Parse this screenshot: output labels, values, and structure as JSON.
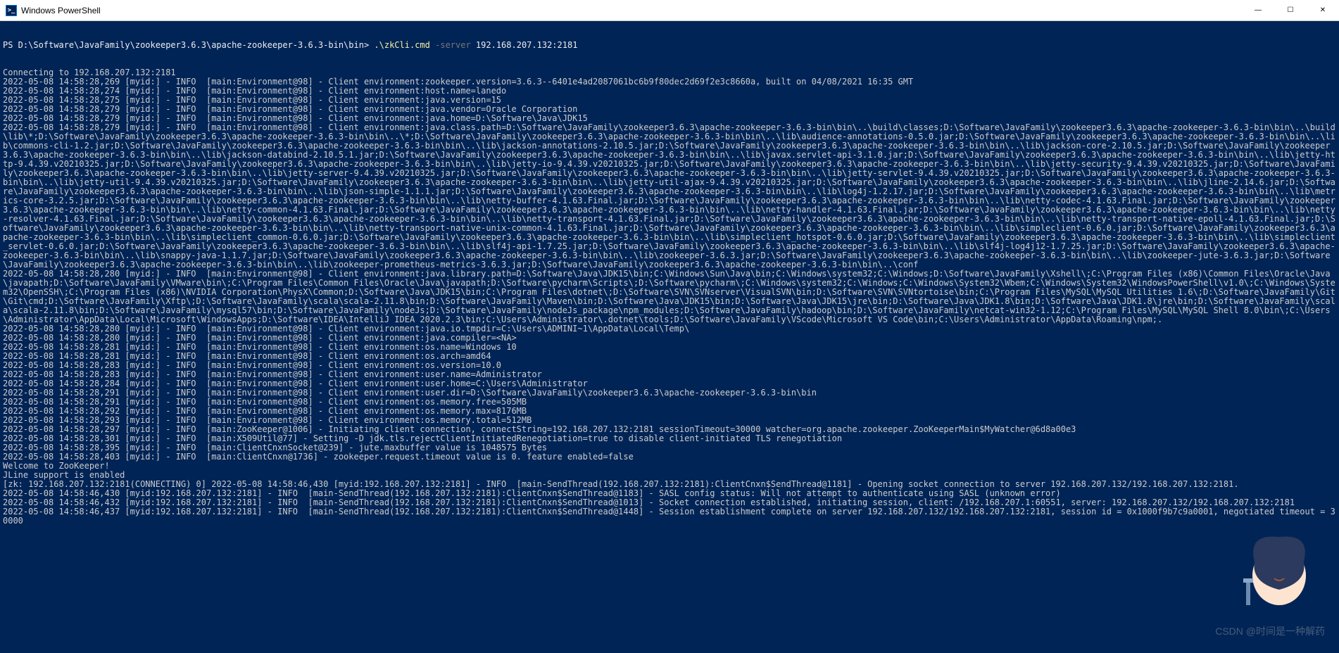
{
  "window": {
    "title": "Windows PowerShell",
    "icon_label": ">_"
  },
  "buttons": {
    "minimize": "—",
    "maximize": "☐",
    "close": "✕"
  },
  "prompt": {
    "path": "PS D:\\Software\\JavaFamily\\zookeeper3.6.3\\apache-zookeeper-3.6.3-bin\\bin> ",
    "command": ".\\zkCli.cmd",
    "flag": "-server",
    "arg": " 192.168.207.132:2181"
  },
  "lines": [
    "Connecting to 192.168.207.132:2181",
    "2022-05-08 14:58:28,269 [myid:] - INFO  [main:Environment@98] - Client environment:zookeeper.version=3.6.3--6401e4ad2087061bc6b9f80dec2d69f2e3c8660a, built on 04/08/2021 16:35 GMT",
    "2022-05-08 14:58:28,274 [myid:] - INFO  [main:Environment@98] - Client environment:host.name=lanedo",
    "2022-05-08 14:58:28,275 [myid:] - INFO  [main:Environment@98] - Client environment:java.version=15",
    "2022-05-08 14:58:28,279 [myid:] - INFO  [main:Environment@98] - Client environment:java.vendor=Oracle Corporation",
    "2022-05-08 14:58:28,279 [myid:] - INFO  [main:Environment@98] - Client environment:java.home=D:\\Software\\Java\\JDK15",
    "2022-05-08 14:58:28,279 [myid:] - INFO  [main:Environment@98] - Client environment:java.class.path=D:\\Software\\JavaFamily\\zookeeper3.6.3\\apache-zookeeper-3.6.3-bin\\bin\\..\\build\\classes;D:\\Software\\JavaFamily\\zookeeper3.6.3\\apache-zookeeper-3.6.3-bin\\bin\\..\\build\\lib\\*;D:\\Software\\JavaFamily\\zookeeper3.6.3\\apache-zookeeper-3.6.3-bin\\bin\\..\\*;D:\\Software\\JavaFamily\\zookeeper3.6.3\\apache-zookeeper-3.6.3-bin\\bin\\..\\lib\\audience-annotations-0.5.0.jar;D:\\Software\\JavaFamily\\zookeeper3.6.3\\apache-zookeeper-3.6.3-bin\\bin\\..\\lib\\commons-cli-1.2.jar;D:\\Software\\JavaFamily\\zookeeper3.6.3\\apache-zookeeper-3.6.3-bin\\bin\\..\\lib\\jackson-annotations-2.10.5.jar;D:\\Software\\JavaFamily\\zookeeper3.6.3\\apache-zookeeper-3.6.3-bin\\bin\\..\\lib\\jackson-core-2.10.5.jar;D:\\Software\\JavaFamily\\zookeeper3.6.3\\apache-zookeeper-3.6.3-bin\\bin\\..\\lib\\jackson-databind-2.10.5.1.jar;D:\\Software\\JavaFamily\\zookeeper3.6.3\\apache-zookeeper-3.6.3-bin\\bin\\..\\lib\\javax.servlet-api-3.1.0.jar;D:\\Software\\JavaFamily\\zookeeper3.6.3\\apache-zookeeper-3.6.3-bin\\bin\\..\\lib\\jetty-http-9.4.39.v20210325.jar;D:\\Software\\JavaFamily\\zookeeper3.6.3\\apache-zookeeper-3.6.3-bin\\bin\\..\\lib\\jetty-io-9.4.39.v20210325.jar;D:\\Software\\JavaFamily\\zookeeper3.6.3\\apache-zookeeper-3.6.3-bin\\bin\\..\\lib\\jetty-security-9.4.39.v20210325.jar;D:\\Software\\JavaFamily\\zookeeper3.6.3\\apache-zookeeper-3.6.3-bin\\bin\\..\\lib\\jetty-server-9.4.39.v20210325.jar;D:\\Software\\JavaFamily\\zookeeper3.6.3\\apache-zookeeper-3.6.3-bin\\bin\\..\\lib\\jetty-servlet-9.4.39.v20210325.jar;D:\\Software\\JavaFamily\\zookeeper3.6.3\\apache-zookeeper-3.6.3-bin\\bin\\..\\lib\\jetty-util-9.4.39.v20210325.jar;D:\\Software\\JavaFamily\\zookeeper3.6.3\\apache-zookeeper-3.6.3-bin\\bin\\..\\lib\\jetty-util-ajax-9.4.39.v20210325.jar;D:\\Software\\JavaFamily\\zookeeper3.6.3\\apache-zookeeper-3.6.3-bin\\bin\\..\\lib\\jline-2.14.6.jar;D:\\Software\\JavaFamily\\zookeeper3.6.3\\apache-zookeeper-3.6.3-bin\\bin\\..\\lib\\json-simple-1.1.1.jar;D:\\Software\\JavaFamily\\zookeeper3.6.3\\apache-zookeeper-3.6.3-bin\\bin\\..\\lib\\log4j-1.2.17.jar;D:\\Software\\JavaFamily\\zookeeper3.6.3\\apache-zookeeper-3.6.3-bin\\bin\\..\\lib\\metrics-core-3.2.5.jar;D:\\Software\\JavaFamily\\zookeeper3.6.3\\apache-zookeeper-3.6.3-bin\\bin\\..\\lib\\netty-buffer-4.1.63.Final.jar;D:\\Software\\JavaFamily\\zookeeper3.6.3\\apache-zookeeper-3.6.3-bin\\bin\\..\\lib\\netty-codec-4.1.63.Final.jar;D:\\Software\\JavaFamily\\zookeeper3.6.3\\apache-zookeeper-3.6.3-bin\\bin\\..\\lib\\netty-common-4.1.63.Final.jar;D:\\Software\\JavaFamily\\zookeeper3.6.3\\apache-zookeeper-3.6.3-bin\\bin\\..\\lib\\netty-handler-4.1.63.Final.jar;D:\\Software\\JavaFamily\\zookeeper3.6.3\\apache-zookeeper-3.6.3-bin\\bin\\..\\lib\\netty-resolver-4.1.63.Final.jar;D:\\Software\\JavaFamily\\zookeeper3.6.3\\apache-zookeeper-3.6.3-bin\\bin\\..\\lib\\netty-transport-4.1.63.Final.jar;D:\\Software\\JavaFamily\\zookeeper3.6.3\\apache-zookeeper-3.6.3-bin\\bin\\..\\lib\\netty-transport-native-epoll-4.1.63.Final.jar;D:\\Software\\JavaFamily\\zookeeper3.6.3\\apache-zookeeper-3.6.3-bin\\bin\\..\\lib\\netty-transport-native-unix-common-4.1.63.Final.jar;D:\\Software\\JavaFamily\\zookeeper3.6.3\\apache-zookeeper-3.6.3-bin\\bin\\..\\lib\\simpleclient-0.6.0.jar;D:\\Software\\JavaFamily\\zookeeper3.6.3\\apache-zookeeper-3.6.3-bin\\bin\\..\\lib\\simpleclient_common-0.6.0.jar;D:\\Software\\JavaFamily\\zookeeper3.6.3\\apache-zookeeper-3.6.3-bin\\bin\\..\\lib\\simpleclient_hotspot-0.6.0.jar;D:\\Software\\JavaFamily\\zookeeper3.6.3\\apache-zookeeper-3.6.3-bin\\bin\\..\\lib\\simpleclient_servlet-0.6.0.jar;D:\\Software\\JavaFamily\\zookeeper3.6.3\\apache-zookeeper-3.6.3-bin\\bin\\..\\lib\\slf4j-api-1.7.25.jar;D:\\Software\\JavaFamily\\zookeeper3.6.3\\apache-zookeeper-3.6.3-bin\\bin\\..\\lib\\slf4j-log4j12-1.7.25.jar;D:\\Software\\JavaFamily\\zookeeper3.6.3\\apache-zookeeper-3.6.3-bin\\bin\\..\\lib\\snappy-java-1.1.7.jar;D:\\Software\\JavaFamily\\zookeeper3.6.3\\apache-zookeeper-3.6.3-bin\\bin\\..\\lib\\zookeeper-3.6.3.jar;D:\\Software\\JavaFamily\\zookeeper3.6.3\\apache-zookeeper-3.6.3-bin\\bin\\..\\lib\\zookeeper-jute-3.6.3.jar;D:\\Software\\JavaFamily\\zookeeper3.6.3\\apache-zookeeper-3.6.3-bin\\bin\\..\\lib\\zookeeper-prometheus-metrics-3.6.3.jar;D:\\Software\\JavaFamily\\zookeeper3.6.3\\apache-zookeeper-3.6.3-bin\\bin\\..\\conf",
    "2022-05-08 14:58:28,280 [myid:] - INFO  [main:Environment@98] - Client environment:java.library.path=D:\\Software\\Java\\JDK15\\bin;C:\\Windows\\Sun\\Java\\bin;C:\\Windows\\system32;C:\\Windows;D:\\Software\\JavaFamily\\Xshell\\;C:\\Program Files (x86)\\Common Files\\Oracle\\Java\\javapath;D:\\Software\\JavaFamily\\VMware\\bin\\;C:\\Program Files\\Common Files\\Oracle\\Java\\javapath;D:\\Software\\pycharm\\Scripts\\;D:\\Software\\pycharm\\;C:\\Windows\\system32;C:\\Windows;C:\\Windows\\System32\\Wbem;C:\\Windows\\System32\\WindowsPowerShell\\v1.0\\;C:\\Windows\\System32\\OpenSSH\\;C:\\Program Files (x86)\\NVIDIA Corporation\\PhysX\\Common;D:\\Software\\Java\\JDK15\\bin;C:\\Program Files\\dotnet\\;D:\\Software\\SVN\\SVNserver\\VisualSVN\\bin;D:\\Software\\SVN\\SVNtortoise\\bin;C:\\Program Files\\MySQL\\MySQL Utilities 1.6\\;D:\\Software\\JavaFamily\\Git\\Git\\cmd;D:\\Software\\JavaFamily\\Xftp\\;D:\\Software\\JavaFamily\\scala\\scala-2.11.8\\bin;D:\\Software\\JavaFamily\\Maven\\bin;D:\\Software\\Java\\JDK15\\bin;D:\\Software\\Java\\JDK15\\jre\\bin;D:\\Software\\Java\\JDK1.8\\bin;D:\\Software\\Java\\JDK1.8\\jre\\bin;D:\\Software\\JavaFamily\\scala\\scala-2.11.8\\bin;D:\\Software\\JavaFamily\\mysql57\\bin;D:\\Software\\JavaFamily\\nodeJs;D:\\Software\\JavaFamily\\nodeJs_package\\npm_modules;D:\\Software\\JavaFamily\\hadoop\\bin;D:\\Software\\JavaFamily\\netcat-win32-1.12;C:\\Program Files\\MySQL\\MySQL Shell 8.0\\bin\\;C:\\Users\\Administrator\\AppData\\Local\\Microsoft\\WindowsApps;D:\\Software\\IDEA\\IntelliJ IDEA 2020.2.3\\bin;C:\\Users\\Administrator\\.dotnet\\tools;D:\\Software\\JavaFamily\\VScode\\Microsoft VS Code\\bin;C:\\Users\\Administrator\\AppData\\Roaming\\npm;.",
    "2022-05-08 14:58:28,280 [myid:] - INFO  [main:Environment@98] - Client environment:java.io.tmpdir=C:\\Users\\ADMINI~1\\AppData\\Local\\Temp\\",
    "2022-05-08 14:58:28,280 [myid:] - INFO  [main:Environment@98] - Client environment:java.compiler=<NA>",
    "2022-05-08 14:58:28,281 [myid:] - INFO  [main:Environment@98] - Client environment:os.name=Windows 10",
    "2022-05-08 14:58:28,281 [myid:] - INFO  [main:Environment@98] - Client environment:os.arch=amd64",
    "2022-05-08 14:58:28,283 [myid:] - INFO  [main:Environment@98] - Client environment:os.version=10.0",
    "2022-05-08 14:58:28,283 [myid:] - INFO  [main:Environment@98] - Client environment:user.name=Administrator",
    "2022-05-08 14:58:28,284 [myid:] - INFO  [main:Environment@98] - Client environment:user.home=C:\\Users\\Administrator",
    "2022-05-08 14:58:28,291 [myid:] - INFO  [main:Environment@98] - Client environment:user.dir=D:\\Software\\JavaFamily\\zookeeper3.6.3\\apache-zookeeper-3.6.3-bin\\bin",
    "2022-05-08 14:58:28,291 [myid:] - INFO  [main:Environment@98] - Client environment:os.memory.free=505MB",
    "2022-05-08 14:58:28,292 [myid:] - INFO  [main:Environment@98] - Client environment:os.memory.max=8176MB",
    "2022-05-08 14:58:28,293 [myid:] - INFO  [main:Environment@98] - Client environment:os.memory.total=512MB",
    "2022-05-08 14:58:28,297 [myid:] - INFO  [main:ZooKeeper@1006] - Initiating client connection, connectString=192.168.207.132:2181 sessionTimeout=30000 watcher=org.apache.zookeeper.ZooKeeperMain$MyWatcher@6d8a00e3",
    "2022-05-08 14:58:28,301 [myid:] - INFO  [main:X509Util@77] - Setting -D jdk.tls.rejectClientInitiatedRenegotiation=true to disable client-initiated TLS renegotiation",
    "2022-05-08 14:58:28,395 [myid:] - INFO  [main:ClientCnxnSocket@239] - jute.maxbuffer value is 1048575 Bytes",
    "2022-05-08 14:58:28,403 [myid:] - INFO  [main:ClientCnxn@1736] - zookeeper.request.timeout value is 0. feature enabled=false",
    "Welcome to ZooKeeper!",
    "JLine support is enabled",
    "[zk: 192.168.207.132:2181(CONNECTING) 0] 2022-05-08 14:58:46,430 [myid:192.168.207.132:2181] - INFO  [main-SendThread(192.168.207.132:2181):ClientCnxn$SendThread@1181] - Opening socket connection to server 192.168.207.132/192.168.207.132:2181.",
    "2022-05-08 14:58:46,430 [myid:192.168.207.132:2181] - INFO  [main-SendThread(192.168.207.132:2181):ClientCnxn$SendThread@1183] - SASL config status: Will not attempt to authenticate using SASL (unknown error)",
    "2022-05-08 14:58:46,432 [myid:192.168.207.132:2181] - INFO  [main-SendThread(192.168.207.132:2181):ClientCnxn$SendThread@1013] - Socket connection established, initiating session, client: /192.168.207.1:60551, server: 192.168.207.132/192.168.207.132:2181",
    "2022-05-08 14:58:46,437 [myid:192.168.207.132:2181] - INFO  [main-SendThread(192.168.207.132:2181):ClientCnxn$SendThread@1448] - Session establishment complete on server 192.168.207.132/192.168.207.132:2181, session id = 0x1000f9b7c9a0001, negotiated timeout = 30000",
    ""
  ],
  "watermark": "CSDN @时间是一种解药"
}
